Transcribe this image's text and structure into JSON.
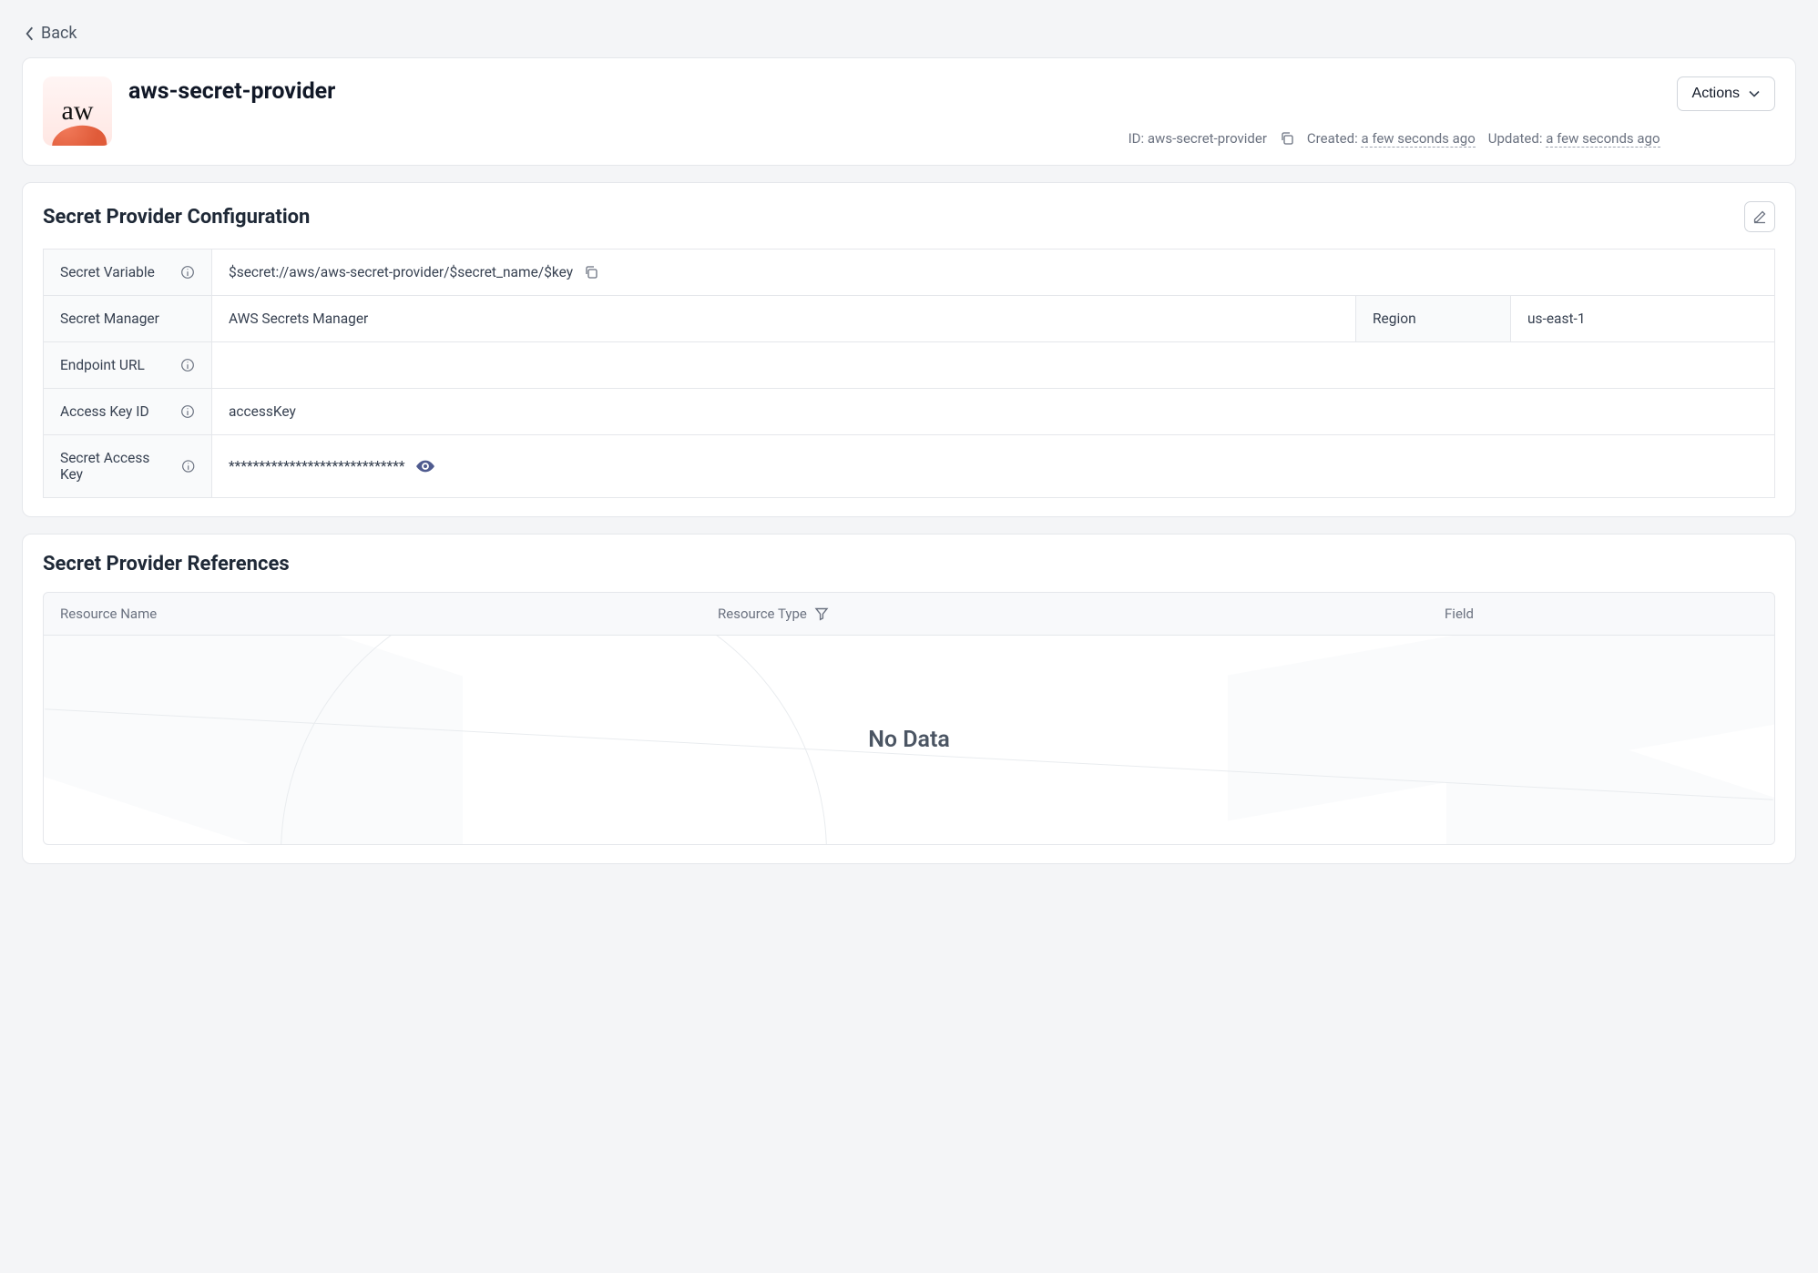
{
  "back_label": "Back",
  "header": {
    "logo_text": "aw",
    "title": "aws-secret-provider",
    "id_label": "ID:",
    "id_value": "aws-secret-provider",
    "created_label": "Created:",
    "created_value": "a few seconds ago",
    "updated_label": "Updated:",
    "updated_value": "a few seconds ago",
    "actions_label": "Actions"
  },
  "config": {
    "section_title": "Secret Provider Configuration",
    "rows": {
      "secret_variable_label": "Secret Variable",
      "secret_variable_value": "$secret://aws/aws-secret-provider/$secret_name/$key",
      "secret_manager_label": "Secret Manager",
      "secret_manager_value": "AWS Secrets Manager",
      "region_label": "Region",
      "region_value": "us-east-1",
      "endpoint_url_label": "Endpoint URL",
      "endpoint_url_value": "",
      "access_key_id_label": "Access Key ID",
      "access_key_id_value": "accessKey",
      "secret_access_key_label": "Secret Access Key",
      "secret_access_key_value": "*****************************"
    }
  },
  "references": {
    "section_title": "Secret Provider References",
    "columns": {
      "resource_name": "Resource Name",
      "resource_type": "Resource Type",
      "field": "Field"
    },
    "no_data": "No Data"
  }
}
